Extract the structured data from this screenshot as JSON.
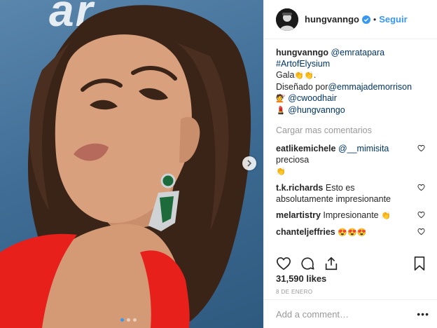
{
  "post": {
    "image_alt": "Portrait photo",
    "watermark": "ar",
    "carousel_dots": 3,
    "carousel_active": 0
  },
  "header": {
    "username": "hungvanngo",
    "separator": "•",
    "follow_label": "Seguir"
  },
  "caption": {
    "user": "hungvanngo",
    "mention1": "@emratapara",
    "hashtag": "#ArtofElysium",
    "line2a": "Gala",
    "line2_emoji": "👏👏",
    "line2b": ".",
    "line3a": "Diseñado por",
    "mention2": "@emmajademorrison",
    "emoji_hair": "💇",
    "mention3": "@cwoodhair",
    "emoji_lipstick": "💄",
    "mention4": "@hungvanngo"
  },
  "load_more": "Cargar mas comentarios",
  "comments": [
    {
      "user": "eatlikemichele",
      "mention": "@__mimisita",
      "text": "preciosa",
      "emoji": "👏"
    },
    {
      "user": "t.k.richards",
      "mention": "",
      "text": "Esto es absolutamente impresionante",
      "emoji": ""
    },
    {
      "user": "melartistry",
      "mention": "",
      "text": "Impresionante",
      "emoji": "👏"
    },
    {
      "user": "chanteljeffries",
      "mention": "",
      "text": "",
      "emoji": "😍😍😍"
    }
  ],
  "likes": "31,590 likes",
  "date": "8 DE ENERO",
  "add_comment_placeholder": "Add a comment…",
  "more_label": "•••",
  "colors": {
    "accent": "#3897f0",
    "text": "#262626",
    "muted": "#999999",
    "dress": "#e8201c"
  }
}
